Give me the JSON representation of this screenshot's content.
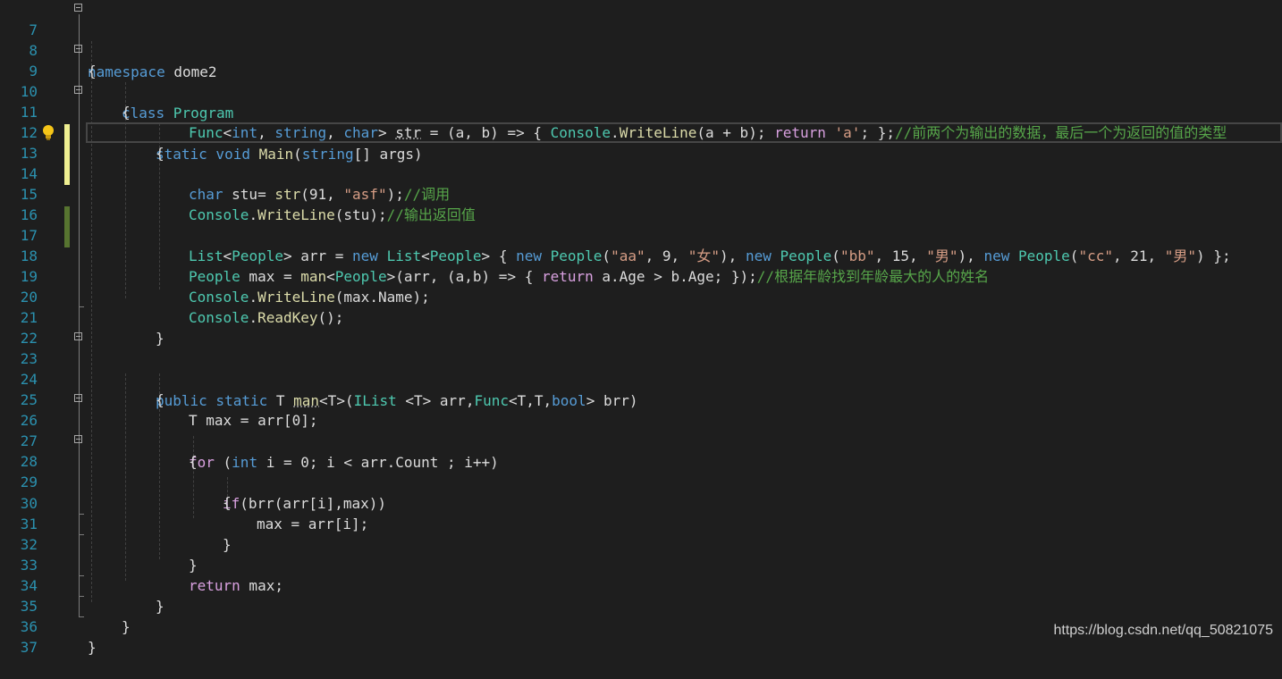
{
  "editor": {
    "lines": [
      {
        "n": "7"
      },
      {
        "n": "8"
      },
      {
        "n": "9"
      },
      {
        "n": "10"
      },
      {
        "n": "11"
      },
      {
        "n": "12"
      },
      {
        "n": "13"
      },
      {
        "n": "14"
      },
      {
        "n": "15"
      },
      {
        "n": "16"
      },
      {
        "n": "17"
      },
      {
        "n": "18"
      },
      {
        "n": "19"
      },
      {
        "n": "20"
      },
      {
        "n": "21"
      },
      {
        "n": "22"
      },
      {
        "n": "23"
      },
      {
        "n": "24"
      },
      {
        "n": "25"
      },
      {
        "n": "26"
      },
      {
        "n": "27"
      },
      {
        "n": "28"
      },
      {
        "n": "29"
      },
      {
        "n": "30"
      },
      {
        "n": "31"
      },
      {
        "n": "32"
      },
      {
        "n": "33"
      },
      {
        "n": "34"
      },
      {
        "n": "35"
      },
      {
        "n": "36"
      },
      {
        "n": "37"
      }
    ],
    "code": {
      "l7": {
        "kw": "namespace",
        "name": " dome2"
      },
      "l8": "{",
      "l9": {
        "kw": "class",
        "name": " Program"
      },
      "l10": "{",
      "l11": {
        "kw1": "static",
        "kw2": " void",
        "mt": " Main",
        "p1": "(",
        "ty": "string",
        "p2": "[] args)"
      },
      "l12": "{",
      "l13": {
        "t1": "Func",
        "p1": "<",
        "k1": "int",
        "p2": ", ",
        "k2": "string",
        "p3": ", ",
        "k3": "char",
        "p4": "> ",
        "v": "str",
        "p5": " = (a, b) => { ",
        "t2": "Console",
        "p6": ".",
        "m1": "WriteLine",
        "p7": "(a + b); ",
        "ret": "return",
        "p8": " ",
        "s": "'a'",
        "p9": "; };",
        "c": "//前两个为输出的数据，最后一个为返回的值的类型"
      },
      "l14": {
        "k": "char",
        "p1": " stu= ",
        "m": "str",
        "p2": "(91, ",
        "s": "\"asf\"",
        "p3": ");",
        "c": "//调用"
      },
      "l15": {
        "t": "Console",
        "p1": ".",
        "m": "WriteLine",
        "p2": "(stu);",
        "c": "//输出返回值"
      },
      "l17": {
        "t1": "List",
        "p1": "<",
        "t2": "People",
        "p2": "> arr = ",
        "k1": "new",
        "p3": " ",
        "t3": "List",
        "p4": "<",
        "t4": "People",
        "p5": "> { ",
        "k2": "new",
        "p6": " ",
        "t5": "People",
        "p7": "(",
        "s1": "\"aa\"",
        "p8": ", 9, ",
        "s2": "\"女\"",
        "p9": "), ",
        "k3": "new",
        "p10": " ",
        "t6": "People",
        "p11": "(",
        "s3": "\"bb\"",
        "p12": ", 15, ",
        "s4": "\"男\"",
        "p13": "), ",
        "k4": "new",
        "p14": " ",
        "t7": "People",
        "p15": "(",
        "s5": "\"cc\"",
        "p16": ", 21, ",
        "s6": "\"男\"",
        "p17": ") };"
      },
      "l18": {
        "t1": "People",
        "p1": " max = ",
        "m": "man",
        "p2": "<",
        "t2": "People",
        "p3": ">(arr, (a,b) => { ",
        "ret": "return",
        "p4": " a.Age > b.Age; });",
        "c": "//根据年龄找到年龄最大的人的姓名"
      },
      "l19": {
        "t": "Console",
        "p1": ".",
        "m": "WriteLine",
        "p2": "(max.Name);"
      },
      "l20": {
        "t": "Console",
        "p1": ".",
        "m": "ReadKey",
        "p2": "();"
      },
      "l21": "}",
      "l23": {
        "k1": "public",
        "k2": " static",
        "p1": " T ",
        "m": "man",
        "p2": "<T>(",
        "t1": "IList",
        "p3": " <T> arr,",
        "t2": "Func",
        "p4": "<T,T,",
        "k3": "bool",
        "p5": "> brr)"
      },
      "l24": "{",
      "l25": {
        "p1": "T max = arr[0];"
      },
      "l26": {
        "k1": "for",
        "p1": " (",
        "k2": "int",
        "p2": " i = 0; i < arr.Count ; i++)"
      },
      "l27": "{",
      "l28": {
        "k": "if",
        "p1": "(brr(arr[i],max))"
      },
      "l29": "{",
      "l30": {
        "p1": "max = arr[i];"
      },
      "l31": "}",
      "l32": "}",
      "l33": {
        "k": "return",
        "p1": " max;"
      },
      "l34": "}",
      "l35": "}",
      "l36": "}"
    }
  },
  "watermark": "https://blog.csdn.net/qq_50821075",
  "colors": {
    "background": "#1e1e1e",
    "line_number": "#2b91af",
    "keyword": "#569cd6",
    "type": "#4ec9b0",
    "method": "#dcdcaa",
    "string": "#d69d85",
    "comment": "#57a64a",
    "control": "#d8a0df",
    "change_yellow": "#efef91",
    "change_green": "#577430"
  },
  "icons": {
    "lightbulb": "lightbulb-icon"
  }
}
